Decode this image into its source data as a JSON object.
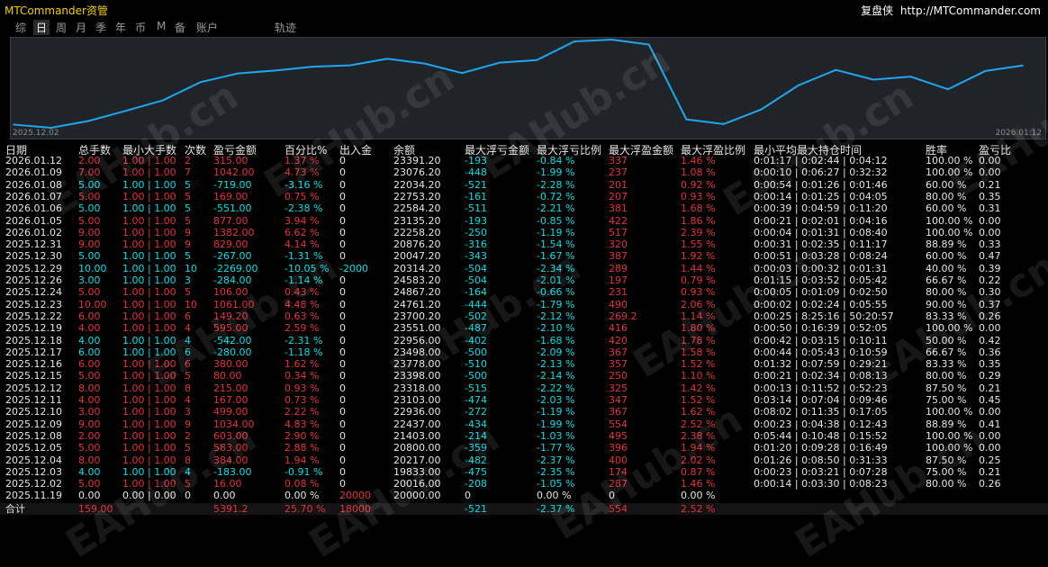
{
  "header": {
    "title": "MTCommander资管",
    "brand_name": "复盘侠",
    "brand_url": "http://MTCommander.com"
  },
  "tabs": [
    {
      "label": "综",
      "active": false
    },
    {
      "label": "日",
      "active": true
    },
    {
      "label": "周",
      "active": false
    },
    {
      "label": "月",
      "active": false
    },
    {
      "label": "季",
      "active": false
    },
    {
      "label": "年",
      "active": false
    },
    {
      "label": "币",
      "active": false
    },
    {
      "label": "M",
      "active": false
    },
    {
      "label": "备",
      "active": false
    },
    {
      "label": "账户",
      "active": false
    },
    {
      "label": "轨迹",
      "active": false
    }
  ],
  "chart_data": {
    "type": "line",
    "x_start_label": "2025.12.02",
    "x_end_label": "2026.01.12",
    "line_color": "#1ea7f0",
    "x": [
      "2025.12.02",
      "2025.12.03",
      "2025.12.04",
      "2025.12.05",
      "2025.12.08",
      "2025.12.09",
      "2025.12.10",
      "2025.12.11",
      "2025.12.12",
      "2025.12.15",
      "2025.12.16",
      "2025.12.17",
      "2025.12.18",
      "2025.12.19",
      "2025.12.22",
      "2025.12.23",
      "2025.12.24",
      "2025.12.26",
      "2025.12.29",
      "2025.12.30",
      "2025.12.31",
      "2026.01.02",
      "2026.01.05",
      "2026.01.06",
      "2026.01.07",
      "2026.01.08",
      "2026.01.09",
      "2026.01.12"
    ],
    "values": [
      20016.0,
      19833.0,
      20217.0,
      20800.0,
      21403.0,
      22437.0,
      22936.0,
      23103.0,
      23318.0,
      23398.0,
      23778.0,
      23498.0,
      22956.0,
      23551.0,
      23700.2,
      24761.2,
      24867.2,
      24583.2,
      20314.2,
      20047.2,
      20876.2,
      22258.2,
      23135.2,
      22584.2,
      22753.2,
      22034.2,
      23076.2,
      23391.2
    ]
  },
  "columns": [
    "日期",
    "总手数",
    "最小大手数",
    "次数",
    "盈亏金额",
    "百分比%",
    "出入金",
    "余额",
    "最大浮亏金额",
    "最大浮亏比例",
    "最大浮盈金额",
    "最大浮盈比例",
    "最小平均最大持仓时间",
    "胜率",
    "盈亏比"
  ],
  "rows": [
    {
      "date": "2026.01.12",
      "lots": "2.00",
      "minmax": "1.00 | 1.00",
      "count": "2",
      "pnl": "315.00",
      "pct": "1.37 %",
      "flow": "0",
      "balance": "23391.20",
      "mdd": "-193",
      "mddp": "-0.84 %",
      "mfe": "337",
      "mfep": "1.46 %",
      "hold": "0:01:17 | 0:02:44 | 0:04:12",
      "win": "100.00 %",
      "ratio": "0.00",
      "dir": "pos"
    },
    {
      "date": "2026.01.09",
      "lots": "7.00",
      "minmax": "1.00 | 1.00",
      "count": "7",
      "pnl": "1042.00",
      "pct": "4.73 %",
      "flow": "0",
      "balance": "23076.20",
      "mdd": "-448",
      "mddp": "-1.99 %",
      "mfe": "237",
      "mfep": "1.08 %",
      "hold": "0:00:10 | 0:06:27 | 0:32:32",
      "win": "100.00 %",
      "ratio": "0.00",
      "dir": "pos"
    },
    {
      "date": "2026.01.08",
      "lots": "5.00",
      "minmax": "1.00 | 1.00",
      "count": "5",
      "pnl": "-719.00",
      "pct": "-3.16 %",
      "flow": "0",
      "balance": "22034.20",
      "mdd": "-521",
      "mddp": "-2.28 %",
      "mfe": "201",
      "mfep": "0.92 %",
      "hold": "0:00:54 | 0:01:26 | 0:01:46",
      "win": "60.00 %",
      "ratio": "0.21",
      "dir": "neg"
    },
    {
      "date": "2026.01.07",
      "lots": "5.00",
      "minmax": "1.00 | 1.00",
      "count": "5",
      "pnl": "169.00",
      "pct": "0.75 %",
      "flow": "0",
      "balance": "22753.20",
      "mdd": "-161",
      "mddp": "-0.72 %",
      "mfe": "207",
      "mfep": "0.93 %",
      "hold": "0:00:14 | 0:01:25 | 0:04:05",
      "win": "80.00 %",
      "ratio": "0.35",
      "dir": "pos"
    },
    {
      "date": "2026.01.06",
      "lots": "5.00",
      "minmax": "1.00 | 1.00",
      "count": "5",
      "pnl": "-551.00",
      "pct": "-2.38 %",
      "flow": "0",
      "balance": "22584.20",
      "mdd": "-511",
      "mddp": "-2.21 %",
      "mfe": "381",
      "mfep": "1.68 %",
      "hold": "0:00:39 | 0:04:59 | 0:11:20",
      "win": "60.00 %",
      "ratio": "0.31",
      "dir": "neg"
    },
    {
      "date": "2026.01.05",
      "lots": "5.00",
      "minmax": "1.00 | 1.00",
      "count": "5",
      "pnl": "877.00",
      "pct": "3.94 %",
      "flow": "0",
      "balance": "23135.20",
      "mdd": "-193",
      "mddp": "-0.85 %",
      "mfe": "422",
      "mfep": "1.86 %",
      "hold": "0:00:21 | 0:02:01 | 0:04:16",
      "win": "100.00 %",
      "ratio": "0.00",
      "dir": "pos"
    },
    {
      "date": "2026.01.02",
      "lots": "9.00",
      "minmax": "1.00 | 1.00",
      "count": "9",
      "pnl": "1382.00",
      "pct": "6.62 %",
      "flow": "0",
      "balance": "22258.20",
      "mdd": "-250",
      "mddp": "-1.19 %",
      "mfe": "517",
      "mfep": "2.39 %",
      "hold": "0:00:04 | 0:01:31 | 0:08:40",
      "win": "100.00 %",
      "ratio": "0.00",
      "dir": "pos"
    },
    {
      "date": "2025.12.31",
      "lots": "9.00",
      "minmax": "1.00 | 1.00",
      "count": "9",
      "pnl": "829.00",
      "pct": "4.14 %",
      "flow": "0",
      "balance": "20876.20",
      "mdd": "-316",
      "mddp": "-1.54 %",
      "mfe": "320",
      "mfep": "1.55 %",
      "hold": "0:00:31 | 0:02:35 | 0:11:17",
      "win": "88.89 %",
      "ratio": "0.33",
      "dir": "pos"
    },
    {
      "date": "2025.12.30",
      "lots": "5.00",
      "minmax": "1.00 | 1.00",
      "count": "5",
      "pnl": "-267.00",
      "pct": "-1.31 %",
      "flow": "0",
      "balance": "20047.20",
      "mdd": "-343",
      "mddp": "-1.67 %",
      "mfe": "387",
      "mfep": "1.92 %",
      "hold": "0:00:51 | 0:03:28 | 0:08:24",
      "win": "60.00 %",
      "ratio": "0.47",
      "dir": "neg"
    },
    {
      "date": "2025.12.29",
      "lots": "10.00",
      "minmax": "1.00 | 1.00",
      "count": "10",
      "pnl": "-2269.00",
      "pct": "-10.05 %",
      "flow": "-2000",
      "balance": "20314.20",
      "mdd": "-504",
      "mddp": "-2.34 %",
      "mfe": "289",
      "mfep": "1.44 %",
      "hold": "0:00:03 | 0:00:32 | 0:01:31",
      "win": "40.00 %",
      "ratio": "0.39",
      "dir": "neg"
    },
    {
      "date": "2025.12.26",
      "lots": "3.00",
      "minmax": "1.00 | 1.00",
      "count": "3",
      "pnl": "-284.00",
      "pct": "-1.14 %",
      "flow": "0",
      "balance": "24583.20",
      "mdd": "-504",
      "mddp": "-2.01 %",
      "mfe": "197",
      "mfep": "0.79 %",
      "hold": "0:01:15 | 0:03:52 | 0:05:42",
      "win": "66.67 %",
      "ratio": "0.22",
      "dir": "neg"
    },
    {
      "date": "2025.12.24",
      "lots": "5.00",
      "minmax": "1.00 | 1.00",
      "count": "5",
      "pnl": "106.00",
      "pct": "0.43 %",
      "flow": "0",
      "balance": "24867.20",
      "mdd": "-164",
      "mddp": "-0.66 %",
      "mfe": "231",
      "mfep": "0.93 %",
      "hold": "0:00:05 | 0:01:09 | 0:02:50",
      "win": "80.00 %",
      "ratio": "0.30",
      "dir": "pos"
    },
    {
      "date": "2025.12.23",
      "lots": "10.00",
      "minmax": "1.00 | 1.00",
      "count": "10",
      "pnl": "1061.00",
      "pct": "4.48 %",
      "flow": "0",
      "balance": "24761.20",
      "mdd": "-444",
      "mddp": "-1.79 %",
      "mfe": "490",
      "mfep": "2.06 %",
      "hold": "0:00:02 | 0:02:24 | 0:05:55",
      "win": "90.00 %",
      "ratio": "0.37",
      "dir": "pos"
    },
    {
      "date": "2025.12.22",
      "lots": "6.00",
      "minmax": "1.00 | 1.00",
      "count": "6",
      "pnl": "149.20",
      "pct": "0.63 %",
      "flow": "0",
      "balance": "23700.20",
      "mdd": "-502",
      "mddp": "-2.12 %",
      "mfe": "269.2",
      "mfep": "1.14 %",
      "hold": "0:00:25 | 8:25:16 | 50:20:57",
      "win": "83.33 %",
      "ratio": "0.26",
      "dir": "pos"
    },
    {
      "date": "2025.12.19",
      "lots": "4.00",
      "minmax": "1.00 | 1.00",
      "count": "4",
      "pnl": "595.00",
      "pct": "2.59 %",
      "flow": "0",
      "balance": "23551.00",
      "mdd": "-487",
      "mddp": "-2.10 %",
      "mfe": "416",
      "mfep": "1.80 %",
      "hold": "0:00:50 | 0:16:39 | 0:52:05",
      "win": "100.00 %",
      "ratio": "0.00",
      "dir": "pos"
    },
    {
      "date": "2025.12.18",
      "lots": "4.00",
      "minmax": "1.00 | 1.00",
      "count": "4",
      "pnl": "-542.00",
      "pct": "-2.31 %",
      "flow": "0",
      "balance": "22956.00",
      "mdd": "-402",
      "mddp": "-1.68 %",
      "mfe": "420",
      "mfep": "1.78 %",
      "hold": "0:00:42 | 0:03:15 | 0:10:11",
      "win": "50.00 %",
      "ratio": "0.42",
      "dir": "neg"
    },
    {
      "date": "2025.12.17",
      "lots": "6.00",
      "minmax": "1.00 | 1.00",
      "count": "6",
      "pnl": "-280.00",
      "pct": "-1.18 %",
      "flow": "0",
      "balance": "23498.00",
      "mdd": "-500",
      "mddp": "-2.09 %",
      "mfe": "367",
      "mfep": "1.58 %",
      "hold": "0:00:44 | 0:05:43 | 0:10:59",
      "win": "66.67 %",
      "ratio": "0.36",
      "dir": "neg"
    },
    {
      "date": "2025.12.16",
      "lots": "6.00",
      "minmax": "1.00 | 1.00",
      "count": "6",
      "pnl": "380.00",
      "pct": "1.62 %",
      "flow": "0",
      "balance": "23778.00",
      "mdd": "-510",
      "mddp": "-2.13 %",
      "mfe": "357",
      "mfep": "1.52 %",
      "hold": "0:01:32 | 0:07:59 | 0:29:21",
      "win": "83.33 %",
      "ratio": "0.35",
      "dir": "pos"
    },
    {
      "date": "2025.12.15",
      "lots": "5.00",
      "minmax": "1.00 | 1.00",
      "count": "5",
      "pnl": "80.00",
      "pct": "0.34 %",
      "flow": "0",
      "balance": "23398.00",
      "mdd": "-500",
      "mddp": "-2.14 %",
      "mfe": "250",
      "mfep": "1.10 %",
      "hold": "0:00:21 | 0:02:34 | 0:08:13",
      "win": "80.00 %",
      "ratio": "0.29",
      "dir": "pos"
    },
    {
      "date": "2025.12.12",
      "lots": "8.00",
      "minmax": "1.00 | 1.00",
      "count": "8",
      "pnl": "215.00",
      "pct": "0.93 %",
      "flow": "0",
      "balance": "23318.00",
      "mdd": "-515",
      "mddp": "-2.22 %",
      "mfe": "325",
      "mfep": "1.42 %",
      "hold": "0:00:13 | 0:11:52 | 0:52:23",
      "win": "87.50 %",
      "ratio": "0.21",
      "dir": "pos"
    },
    {
      "date": "2025.12.11",
      "lots": "4.00",
      "minmax": "1.00 | 1.00",
      "count": "4",
      "pnl": "167.00",
      "pct": "0.73 %",
      "flow": "0",
      "balance": "23103.00",
      "mdd": "-474",
      "mddp": "-2.03 %",
      "mfe": "347",
      "mfep": "1.52 %",
      "hold": "0:03:14 | 0:07:04 | 0:09:46",
      "win": "75.00 %",
      "ratio": "0.45",
      "dir": "pos"
    },
    {
      "date": "2025.12.10",
      "lots": "3.00",
      "minmax": "1.00 | 1.00",
      "count": "3",
      "pnl": "499.00",
      "pct": "2.22 %",
      "flow": "0",
      "balance": "22936.00",
      "mdd": "-272",
      "mddp": "-1.19 %",
      "mfe": "367",
      "mfep": "1.62 %",
      "hold": "0:08:02 | 0:11:35 | 0:17:05",
      "win": "100.00 %",
      "ratio": "0.00",
      "dir": "pos"
    },
    {
      "date": "2025.12.09",
      "lots": "9.00",
      "minmax": "1.00 | 1.00",
      "count": "9",
      "pnl": "1034.00",
      "pct": "4.83 %",
      "flow": "0",
      "balance": "22437.00",
      "mdd": "-434",
      "mddp": "-1.99 %",
      "mfe": "554",
      "mfep": "2.52 %",
      "hold": "0:00:23 | 0:04:38 | 0:12:43",
      "win": "88.89 %",
      "ratio": "0.41",
      "dir": "pos"
    },
    {
      "date": "2025.12.08",
      "lots": "2.00",
      "minmax": "1.00 | 1.00",
      "count": "2",
      "pnl": "603.00",
      "pct": "2.90 %",
      "flow": "0",
      "balance": "21403.00",
      "mdd": "-214",
      "mddp": "-1.03 %",
      "mfe": "495",
      "mfep": "2.38 %",
      "hold": "0:05:44 | 0:10:48 | 0:15:52",
      "win": "100.00 %",
      "ratio": "0.00",
      "dir": "pos"
    },
    {
      "date": "2025.12.05",
      "lots": "5.00",
      "minmax": "1.00 | 1.00",
      "count": "5",
      "pnl": "583.00",
      "pct": "2.88 %",
      "flow": "0",
      "balance": "20800.00",
      "mdd": "-359",
      "mddp": "-1.77 %",
      "mfe": "396",
      "mfep": "1.94 %",
      "hold": "0:01:20 | 0:09:28 | 0:16:49",
      "win": "100.00 %",
      "ratio": "0.00",
      "dir": "pos"
    },
    {
      "date": "2025.12.04",
      "lots": "8.00",
      "minmax": "1.00 | 1.00",
      "count": "8",
      "pnl": "384.00",
      "pct": "1.94 %",
      "flow": "0",
      "balance": "20217.00",
      "mdd": "-482",
      "mddp": "-2.37 %",
      "mfe": "400",
      "mfep": "2.02 %",
      "hold": "0:01:26 | 0:08:50 | 0:31:33",
      "win": "87.50 %",
      "ratio": "0.25",
      "dir": "pos"
    },
    {
      "date": "2025.12.03",
      "lots": "4.00",
      "minmax": "1.00 | 1.00",
      "count": "4",
      "pnl": "-183.00",
      "pct": "-0.91 %",
      "flow": "0",
      "balance": "19833.00",
      "mdd": "-475",
      "mddp": "-2.35 %",
      "mfe": "174",
      "mfep": "0.87 %",
      "hold": "0:00:23 | 0:03:21 | 0:07:28",
      "win": "75.00 %",
      "ratio": "0.21",
      "dir": "neg"
    },
    {
      "date": "2025.12.02",
      "lots": "5.00",
      "minmax": "1.00 | 1.00",
      "count": "5",
      "pnl": "16.00",
      "pct": "0.08 %",
      "flow": "0",
      "balance": "20016.00",
      "mdd": "-208",
      "mddp": "-1.05 %",
      "mfe": "287",
      "mfep": "1.46 %",
      "hold": "0:00:14 | 0:03:30 | 0:08:23",
      "win": "80.00 %",
      "ratio": "0.26",
      "dir": "pos"
    },
    {
      "date": "2025.11.19",
      "lots": "0.00",
      "minmax": "0.00 | 0.00",
      "count": "0",
      "pnl": "0.00",
      "pct": "0.00 %",
      "flow": "20000",
      "balance": "20000.00",
      "mdd": "0",
      "mddp": "0.00 %",
      "mfe": "0",
      "mfep": "0.00 %",
      "hold": "",
      "win": "",
      "ratio": "",
      "dir": "zero"
    }
  ],
  "totals": {
    "label": "合计",
    "lots": "159.00",
    "pnl": "5391.2",
    "pct": "25.70 %",
    "flow": "18000",
    "mdd": "-521",
    "mddp": "-2.37 %",
    "mfe": "554",
    "mfep": "2.52 %"
  },
  "colors": {
    "positive": "#e8313b",
    "negative": "#00e0e6",
    "accent": "#1ea7f0",
    "title": "#f2d000"
  },
  "watermark_text": "EAHub.cn"
}
